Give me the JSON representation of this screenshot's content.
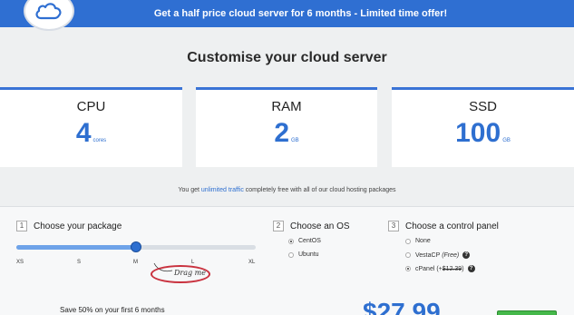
{
  "banner": {
    "text": "Get a half price cloud server for 6 months - Limited time offer!",
    "logo_icon": "cloud-icon"
  },
  "page_title": "Customise your cloud server",
  "specs": [
    {
      "title": "CPU",
      "value": "4",
      "unit": "cores"
    },
    {
      "title": "RAM",
      "value": "2",
      "unit": "GB"
    },
    {
      "title": "SSD",
      "value": "100",
      "unit": "GB"
    }
  ],
  "traffic": {
    "prefix": "You get ",
    "highlight": "unlimited traffic",
    "suffix": " completely free with all of our cloud hosting packages"
  },
  "step1": {
    "number": "1",
    "title": "Choose your package",
    "ticks": [
      "XS",
      "S",
      "M",
      "L",
      "XL"
    ],
    "selected": "M",
    "slider_value": 0.5,
    "hint": "Drag me"
  },
  "step2": {
    "number": "2",
    "title": "Choose an OS",
    "options": [
      "CentOS",
      "Ubuntu"
    ],
    "selected": "CentOS"
  },
  "step3": {
    "number": "3",
    "title": "Choose a control panel",
    "options": {
      "none": "None",
      "vesta": "VestaCP",
      "vesta_tag": "(Free)",
      "cpanel": "cPanel (+",
      "cpanel_price": "$12.39",
      "cpanel_close": ")"
    },
    "selected": "cPanel"
  },
  "footer": {
    "save_text": "Save 50% on your first 6 months",
    "price": "$27.99"
  },
  "colors": {
    "accent": "#2e6fd0",
    "banner": "#2f6fd2",
    "buy_button": "#45b84a",
    "drag_oval": "#c9323f"
  }
}
